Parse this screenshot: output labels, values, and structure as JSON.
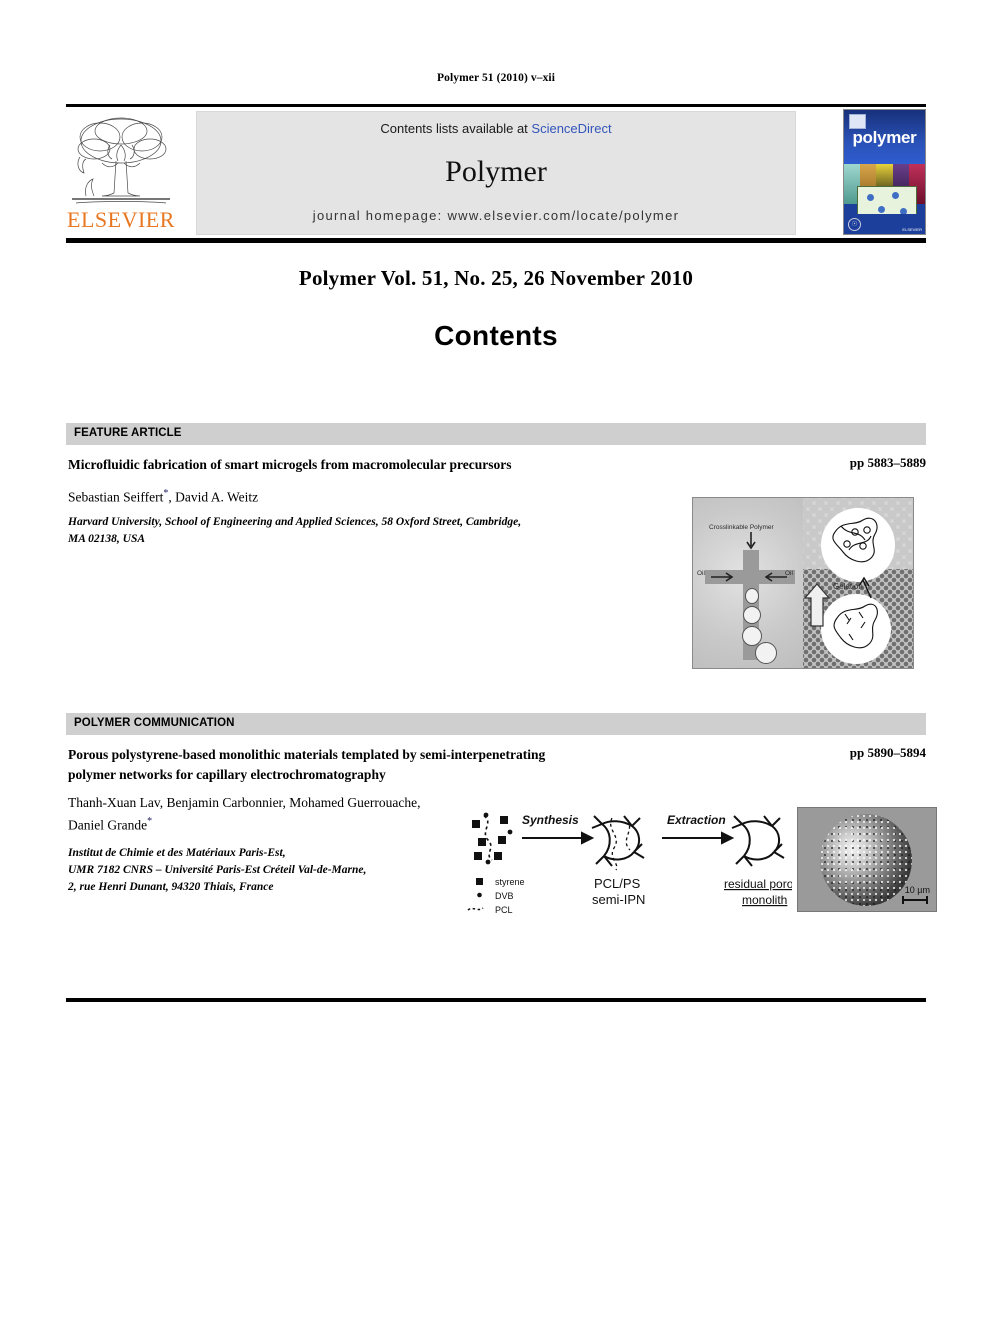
{
  "running_head": "Polymer 51 (2010) v–xii",
  "masthead": {
    "publisher_name": "ELSEVIER",
    "contents_lists_text": "Contents lists available at ",
    "sciencedirect_label": "ScienceDirect",
    "journal_title": "Polymer",
    "homepage_line": "journal homepage: www.elsevier.com/locate/polymer",
    "cover_title": "polymer",
    "cover_imprint": "ELSEVIER"
  },
  "volume_line": "Polymer Vol. 51, No. 25, 26 November 2010",
  "contents_heading": "Contents",
  "sections": [
    {
      "label": "FEATURE ARTICLE",
      "article": {
        "title": "Microfluidic fabrication of smart microgels from macromolecular precursors",
        "pages": "pp 5883–5889",
        "authors_before_star": "Sebastian Seiffert",
        "star": "*",
        "authors_after_star": ", David A. Weitz",
        "affiliation_line1": "Harvard University, School of Engineering and Applied Sciences, 58 Oxford Street, Cambridge,",
        "affiliation_line2": "MA 02138, USA",
        "graphic_labels": {
          "crosslinkable_polymer": "Crosslinkable Polymer",
          "oil_left": "Oil",
          "oil_right": "Oil",
          "gelation": "Gelation"
        }
      }
    },
    {
      "label": "POLYMER COMMUNICATION",
      "article": {
        "title_line1": "Porous polystyrene-based monolithic materials templated by semi-interpenetrating",
        "title_line2": "polymer networks for capillary electrochromatography",
        "pages": "pp 5890–5894",
        "authors_line1": "Thanh-Xuan Lav, Benjamin Carbonnier, Mohamed Guerrouache,",
        "authors_line2_before_star": "Daniel Grande",
        "star": "*",
        "affiliation_line1": "Institut de Chimie et des Matériaux Paris-Est,",
        "affiliation_line2": "UMR 7182 CNRS – Université Paris-Est Créteil Val-de-Marne,",
        "affiliation_line3": "2, rue Henri Dunant, 94320 Thiais, France",
        "graphic_labels": {
          "step1": "Synthesis",
          "step2": "Extraction",
          "product1_line1": "PCL/PS",
          "product1_line2": "semi-IPN",
          "product2_line1": "residual porous",
          "product2_line2": "monolith",
          "legend_styrene": "styrene",
          "legend_dvb": "DVB",
          "legend_pcl": "PCL",
          "scale_bar": "10 µm"
        }
      }
    }
  ],
  "colors": {
    "elsevier_orange": "#E87722",
    "sciencedirect_blue": "#3355bb",
    "section_bar_gray": "#cfcfcf",
    "masthead_band_gray": "#e4e4e4",
    "cover_blue": "#1d3f9c"
  }
}
